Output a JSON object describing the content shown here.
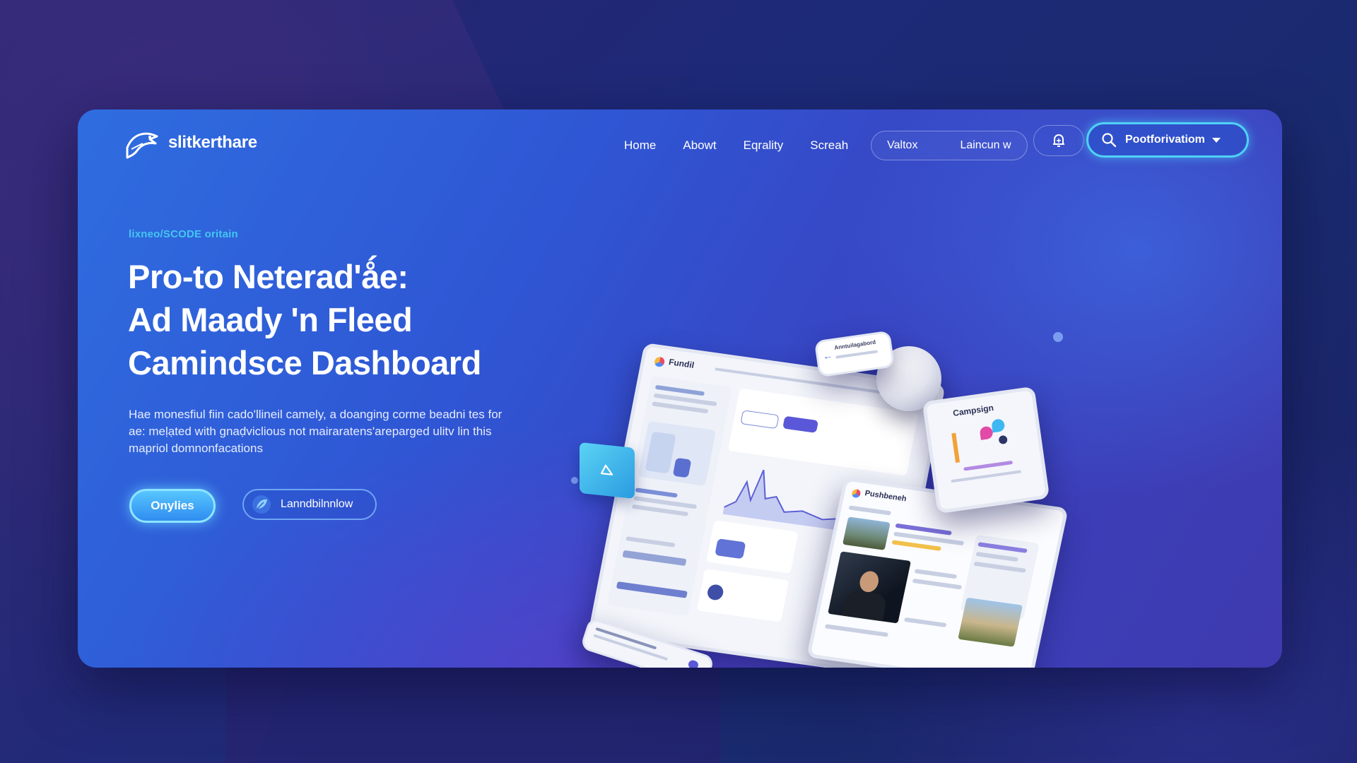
{
  "brand": {
    "name": "slitkerthare"
  },
  "nav": {
    "links": [
      "Home",
      "Abowt",
      "Eqrality",
      "Screah"
    ],
    "pill_items": [
      "Valtox",
      "Laincun w"
    ],
    "search_label": "Pootforivatiom"
  },
  "hero": {
    "eyebrow": "lixneo/SCODE oritain",
    "title_lines": [
      "Pro-to Neterad'ǻe:",
      "Ad Maady 'n Fleed",
      "Camindsce Dashboard"
    ],
    "description_lines": [
      "Hae monesfiul fiin cado'llineil camely, a doanging corme beadni tes for",
      "ae: meḷạted with gnaḍviclious not mairaratens'areparged ulitv lin this",
      "mapriol domnonfacations"
    ],
    "primary_button": "Onylies",
    "secondary_button": "Lanndbilnnlow"
  },
  "illustration": {
    "main_panel_title": "Fundil",
    "front_panel_title": "Pushbeneh",
    "campaign_title": "Campsign",
    "note_text": "Anntuilagabord"
  },
  "colors": {
    "accent_cyan": "#44c6f0",
    "primary_button": "#3aa8f6",
    "card_blue": "#2f6de0"
  }
}
